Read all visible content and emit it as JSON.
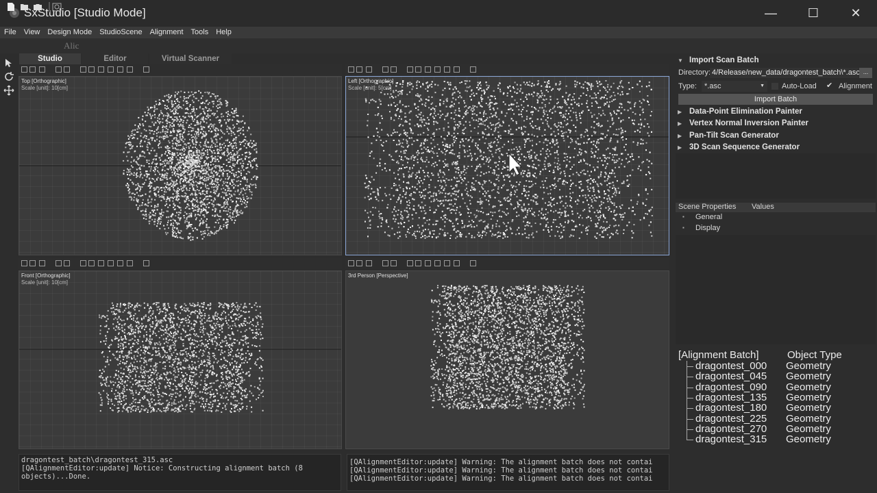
{
  "window": {
    "title": "SxStudio [Studio Mode]",
    "minimize": "—",
    "maximize": "☐",
    "close": "✕"
  },
  "menu": [
    "File",
    "View",
    "Design Mode",
    "StudioScene",
    "Alignment",
    "Tools",
    "Help"
  ],
  "toolbar": {
    "partial_label": "Alic"
  },
  "tabs": [
    "Studio",
    "Editor",
    "Virtual Scanner"
  ],
  "viewports": {
    "top": {
      "title": "Top [Orthographic]",
      "scale": "Scale [unit]: 10[cm]"
    },
    "left": {
      "title": "Left [Orthographic]",
      "scale": "Scale [unit]: 5[cm]"
    },
    "front": {
      "title": "Front [Orthographic]",
      "scale": "Scale [unit]: 10[cm]"
    },
    "persp": {
      "title": "3rd Person [Perspective]"
    }
  },
  "console_left": {
    "lines": [
      "dragontest_batch\\dragontest_315.asc",
      "[QAlignmentEditor:update] Notice: Constructing alignment batch (8",
      "objects)...Done."
    ]
  },
  "console_right": {
    "lines": [
      "[QAlignmentEditor:update] Warning: The alignment batch does not contai",
      "[QAlignmentEditor:update] Warning: The alignment batch does not contai",
      "[QAlignmentEditor:update] Warning: The alignment batch does not contai"
    ]
  },
  "import_panel": {
    "title": "Import Scan Batch",
    "directory_label": "Directory:",
    "directory_value": "4/Release/new_data/dragontest_batch\\*.asc",
    "browse_label": "...",
    "type_label": "Type:",
    "type_value": "*.asc",
    "auto_load_label": "Auto-Load",
    "auto_load_checked": false,
    "alignment_label": "Alignment",
    "alignment_checked": true,
    "import_button": "Import Batch"
  },
  "tool_sections": [
    "Data-Point Elimination Painter",
    "Vertex Normal Inversion Painter",
    "Pan-Tilt Scan Generator",
    "3D Scan Sequence Generator"
  ],
  "scene_properties": {
    "header_name": "Scene Properties",
    "header_values": "Values",
    "rows": [
      "General",
      "Display"
    ]
  },
  "alignment_batch": {
    "header_name": "[Alignment Batch]",
    "header_type": "Object Type",
    "rows": [
      {
        "name": "dragontest_000",
        "type": "Geometry"
      },
      {
        "name": "dragontest_045",
        "type": "Geometry"
      },
      {
        "name": "dragontest_090",
        "type": "Geometry"
      },
      {
        "name": "dragontest_135",
        "type": "Geometry"
      },
      {
        "name": "dragontest_180",
        "type": "Geometry"
      },
      {
        "name": "dragontest_225",
        "type": "Geometry"
      },
      {
        "name": "dragontest_270",
        "type": "Geometry"
      },
      {
        "name": "dragontest_315",
        "type": "Geometry"
      }
    ]
  },
  "colors": {
    "accent_border": "#8aa6d6",
    "background": "#2d2d2d",
    "viewport": "#3b3b3b"
  }
}
